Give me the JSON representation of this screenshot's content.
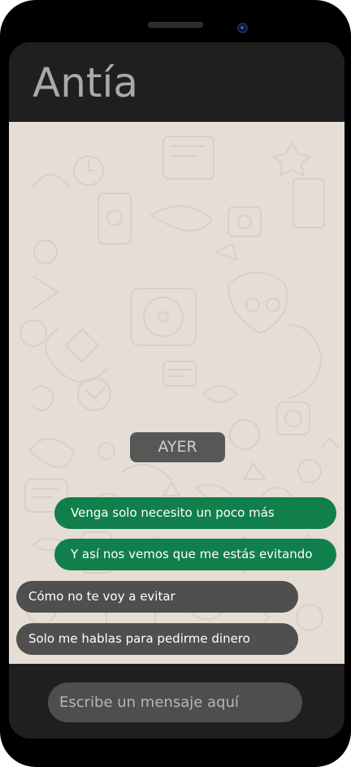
{
  "header": {
    "contact_name": "Antía"
  },
  "chat": {
    "date_divider": "AYER",
    "messages": [
      {
        "direction": "outgoing",
        "text": "Venga solo necesito un poco más"
      },
      {
        "direction": "outgoing",
        "text": "Y así nos vemos que me estás evitando"
      },
      {
        "direction": "incoming",
        "text": "Cómo no te voy a evitar"
      },
      {
        "direction": "incoming",
        "text": "Solo me hablas para pedirme dinero"
      }
    ]
  },
  "composer": {
    "placeholder": "Escribe un mensaje aquí"
  },
  "colors": {
    "outgoing_bubble": "#117f4c",
    "incoming_bubble": "#4f4f4f",
    "chat_background": "#e6ddd4",
    "app_bar": "#1f1f1f"
  }
}
